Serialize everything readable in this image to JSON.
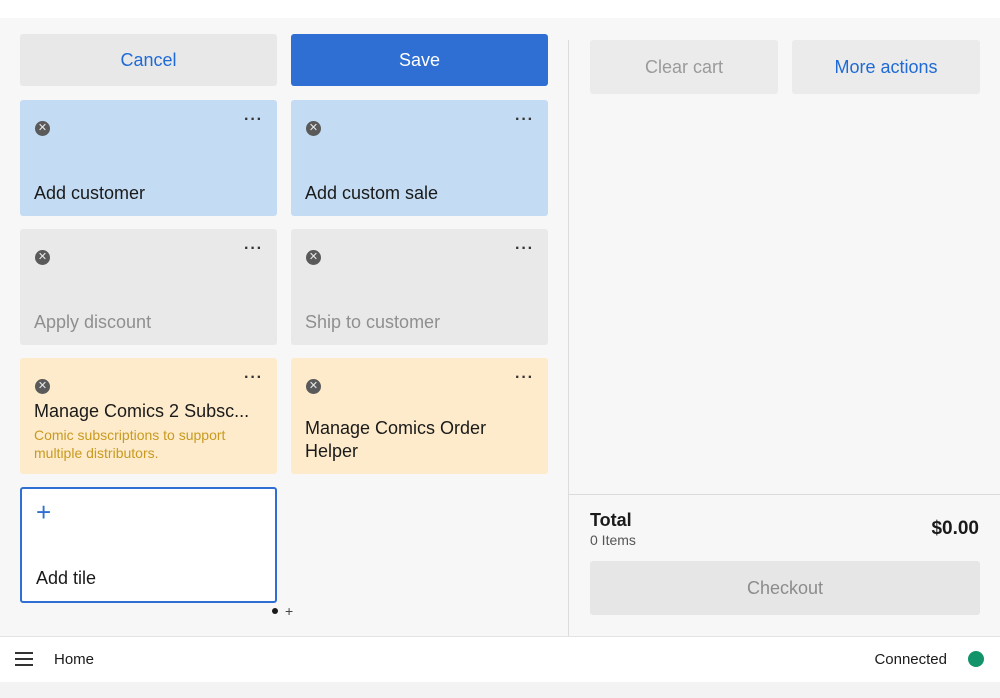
{
  "colors": {
    "accent_blue": "#2f6fd4",
    "tile_blue": "#c3dcf3",
    "tile_gray": "#e9e9e9",
    "tile_orange": "#fdebcc",
    "subtitle_gold": "#c99a1f",
    "status_green": "#12936a"
  },
  "edit_toolbar": {
    "cancel_label": "Cancel",
    "save_label": "Save"
  },
  "tiles": [
    {
      "label": "Add customer",
      "style": "blue",
      "remove_icon": "close-circle-icon",
      "menu_icon": "more-dots-icon"
    },
    {
      "label": "Add custom sale",
      "style": "blue",
      "remove_icon": "close-circle-icon",
      "menu_icon": "more-dots-icon"
    },
    {
      "label": "Apply discount",
      "style": "gray",
      "remove_icon": "close-circle-icon",
      "menu_icon": "more-dots-icon"
    },
    {
      "label": "Ship to customer",
      "style": "gray",
      "remove_icon": "close-circle-icon",
      "menu_icon": "more-dots-icon"
    },
    {
      "label": "Manage Comics 2 Subsc...",
      "subtitle": "Comic subscriptions to support multiple distributors.",
      "style": "orange",
      "remove_icon": "close-circle-icon",
      "menu_icon": "more-dots-icon"
    },
    {
      "label": "Manage Comics Order Helper",
      "style": "orange",
      "remove_icon": "close-circle-icon",
      "menu_icon": "more-dots-icon"
    }
  ],
  "add_tile": {
    "label": "Add tile",
    "icon": "plus-icon"
  },
  "pagination": {
    "active_page": 1,
    "add_page_glyph": "+"
  },
  "cart": {
    "clear_label": "Clear cart",
    "more_actions_label": "More actions",
    "total_label": "Total",
    "items_count": "0 Items",
    "total_amount": "$0.00",
    "checkout_label": "Checkout"
  },
  "bottom_bar": {
    "menu_icon": "hamburger-menu-icon",
    "home_label": "Home",
    "status_label": "Connected",
    "status_icon": "status-dot-icon"
  }
}
